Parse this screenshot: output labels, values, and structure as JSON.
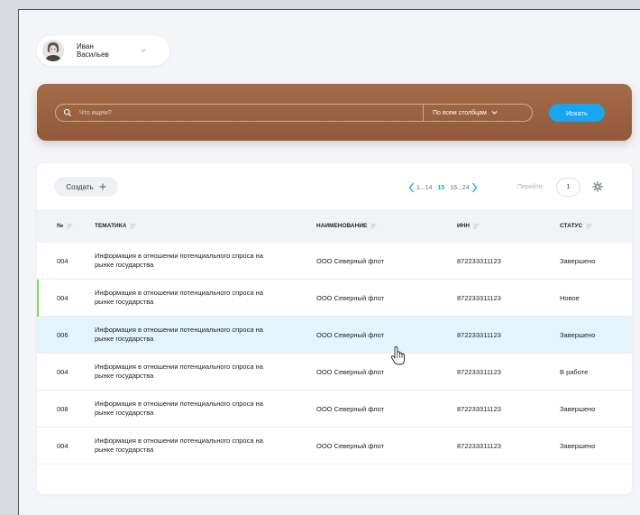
{
  "user": {
    "first_name": "Иван",
    "last_name": "Васильев",
    "avatar_icon": "person-portrait-icon",
    "dropdown_icon": "chevron-down-icon"
  },
  "search": {
    "placeholder": "Что ищем?",
    "value": "",
    "scope_label": "По всем столбцам",
    "button_label": "Искать"
  },
  "toolbar": {
    "create_label": "Создать",
    "pagination": {
      "prev_range": "1...14",
      "current": "15",
      "next_range": "16...24"
    },
    "goto_label": "Перейти",
    "goto_value": "1",
    "settings_icon": "gear-icon"
  },
  "table": {
    "columns": [
      "№",
      "ТЕМАТИКА",
      "НАИМЕНОВАНИЕ",
      "ИНН",
      "СТАТУС"
    ],
    "rows": [
      {
        "num": "004",
        "topic": "Информация в отношении потенциального спроса на рынке государства",
        "name": "ООО Северный флот",
        "inn": "872233311123",
        "status": "Завершено"
      },
      {
        "num": "004",
        "topic": "Информация в отношении потенциального спроса на рынке государства",
        "name": "ООО Северный флот",
        "inn": "872233311123",
        "status": "Новое"
      },
      {
        "num": "006",
        "topic": "Информация в отношении потенциального спроса на рынке государства",
        "name": "ООО Северный флот",
        "inn": "872233311123",
        "status": "Завершено"
      },
      {
        "num": "004",
        "topic": "Информация в отношении потенциального спроса на рынке государства",
        "name": "ООО Северный флот",
        "inn": "872233311123",
        "status": "В работе"
      },
      {
        "num": "008",
        "topic": "Информация в отношении потенциального спроса на рынке государства",
        "name": "ООО Северный флот",
        "inn": "872233311123",
        "status": "Завершено"
      },
      {
        "num": "004",
        "topic": "Информация в отношении потенциального спроса на рынке государства",
        "name": "ООО Северный флот",
        "inn": "872233311123",
        "status": "Завершено"
      }
    ]
  },
  "colors": {
    "accent_blue": "#19a5f0",
    "band_brown": "#9b6240",
    "new_row_marker": "#7ed957",
    "highlight_row": "#e3f4fc"
  }
}
